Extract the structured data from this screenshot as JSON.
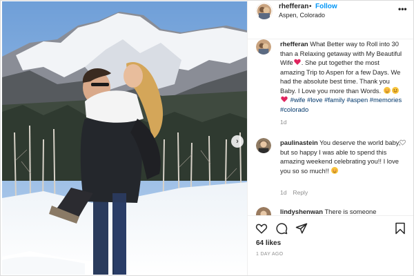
{
  "post": {
    "username": "rhefferan",
    "follow_label": "Follow",
    "separator": "•",
    "location": "Aspen, Colorado",
    "more_label": "•••"
  },
  "caption": {
    "username": "rhefferan",
    "text_part1": "What Better way to Roll into 30 than a Relaxing getaway with My Beautiful Wife",
    "text_part2": ". She put together the most amazing Trip to Aspen for a few Days. We had the absolute best time. Thank you Baby. I Love you more than Words.",
    "hashtags": "#wife #love #family #aspen #memories #colorado",
    "hashtag_list": [
      "#wife",
      "#love",
      "#family",
      "#aspen",
      "#memories",
      "#colorado"
    ],
    "time": "1d"
  },
  "comments": [
    {
      "username": "paulinastein",
      "text": "You deserve the world baby, but so happy I was able to spend this amazing weekend celebrating you!! I love you so so much!!",
      "time": "1d",
      "reply_label": "Reply"
    },
    {
      "username": "lindyshenwan",
      "text": "There is someone"
    }
  ],
  "actions": {
    "likes": "64 likes",
    "time_ago": "1 DAY AGO"
  },
  "icons": {
    "like": "heart-icon",
    "comment": "comment-icon",
    "share": "share-icon",
    "save": "bookmark-icon",
    "next": "chevron-right-icon"
  },
  "colors": {
    "link": "#0095f6",
    "hashtag": "#00376b",
    "muted": "#8e8e8e",
    "text": "#262626",
    "heart": "#ed4956"
  }
}
